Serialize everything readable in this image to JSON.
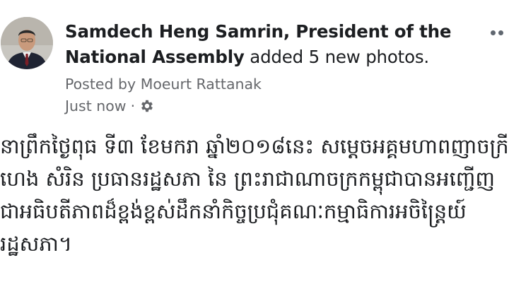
{
  "post": {
    "author": "Samdech Heng Samrin, President of the National Assembly",
    "action": "added 5 new photos.",
    "posted_by": "Posted by Moeurt Rattanak",
    "timestamp": "Just now",
    "separator": "·",
    "privacy_icon": "gear-icon",
    "more_icon": "more-options-icon",
    "avatar_icon": "profile-photo",
    "body_lines": [
      "នាព្រឹកថ្ងៃពុធ ទី៣ ខែមករា ឆ្នាំ២០១៨នេះ  សម្តេចអគ្គមហាពញាចក្រី",
      "ហេង សំរិន ប្រធានរដ្ឋសភា នៃ ព្រះរាជាណាចក្រកម្ពុជាបានអញ្ជើញ",
      "ជាអធិបតីភាពដ៏ខ្ពង់ខ្ពស់ដឹកនាំកិច្ចប្រជុំគណៈកម្មាធិការអចិន្ត្រៃយ៍",
      "រដ្ឋសភា។"
    ]
  },
  "colors": {
    "text_primary": "#1c1e21",
    "text_secondary": "#65676b",
    "background": "#ffffff"
  }
}
